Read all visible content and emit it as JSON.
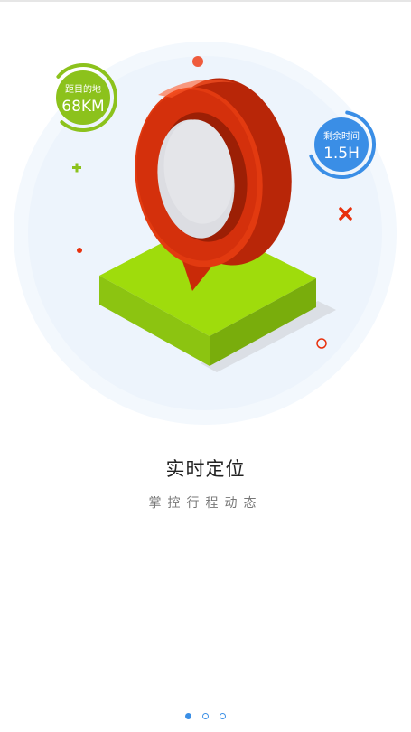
{
  "page": {
    "title": "实时定位",
    "subtitle": "掌控行程动态"
  },
  "badges": {
    "distance": {
      "label": "距目的地",
      "value": "68KM",
      "color": "#8cc21c"
    },
    "time_left": {
      "label": "剩余时间",
      "value": "1.5H",
      "color": "#3a8ee6"
    }
  },
  "pager": {
    "total": 3,
    "active_index": 0
  },
  "colors": {
    "pin": "#e8300c",
    "platform": "#9ad80a",
    "background_circle": "#eef5fc"
  },
  "icons": [
    "map-pin-icon",
    "plus-icon",
    "cross-icon",
    "ring-icon",
    "dot-icon"
  ]
}
